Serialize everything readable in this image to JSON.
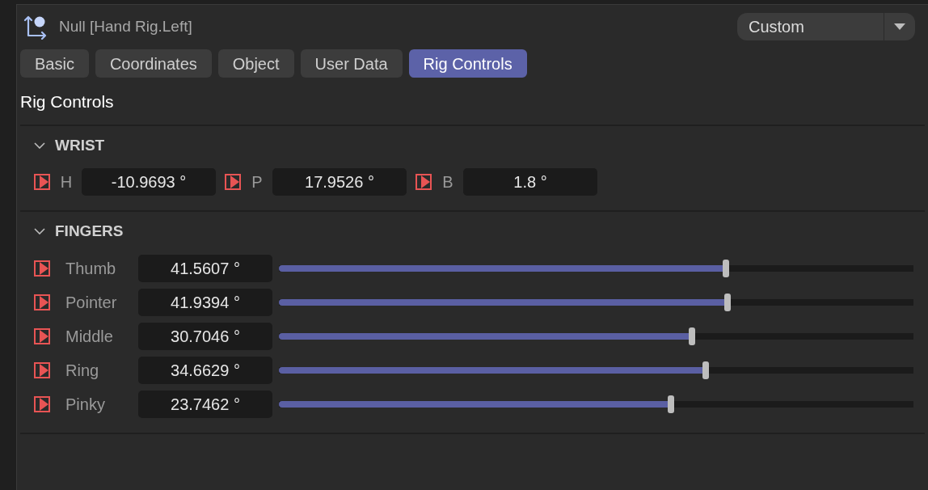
{
  "header": {
    "title": "Null [Hand Rig.Left]",
    "mode_dropdown": {
      "value": "Custom"
    }
  },
  "tabs": [
    {
      "label": "Basic",
      "selected": false
    },
    {
      "label": "Coordinates",
      "selected": false
    },
    {
      "label": "Object",
      "selected": false
    },
    {
      "label": "User Data",
      "selected": false
    },
    {
      "label": "Rig Controls",
      "selected": true
    }
  ],
  "panel_title": "Rig Controls",
  "sections": [
    {
      "title": "WRIST",
      "expanded": true,
      "kind": "inline",
      "fields": [
        {
          "label": "H",
          "value": "-10.9693 °"
        },
        {
          "label": "P",
          "value": "17.9526 °"
        },
        {
          "label": "B",
          "value": "1.8 °"
        }
      ]
    },
    {
      "title": "FINGERS",
      "expanded": true,
      "kind": "sliders",
      "fields": [
        {
          "label": "Thumb",
          "value": "41.5607 °",
          "level": 0.705
        },
        {
          "label": "Pointer",
          "value": "41.9394 °",
          "level": 0.707
        },
        {
          "label": "Middle",
          "value": "30.7046 °",
          "level": 0.651
        },
        {
          "label": "Ring",
          "value": "34.6629 °",
          "level": 0.672
        },
        {
          "label": "Pinky",
          "value": "23.7462 °",
          "level": 0.618
        }
      ]
    }
  ]
}
